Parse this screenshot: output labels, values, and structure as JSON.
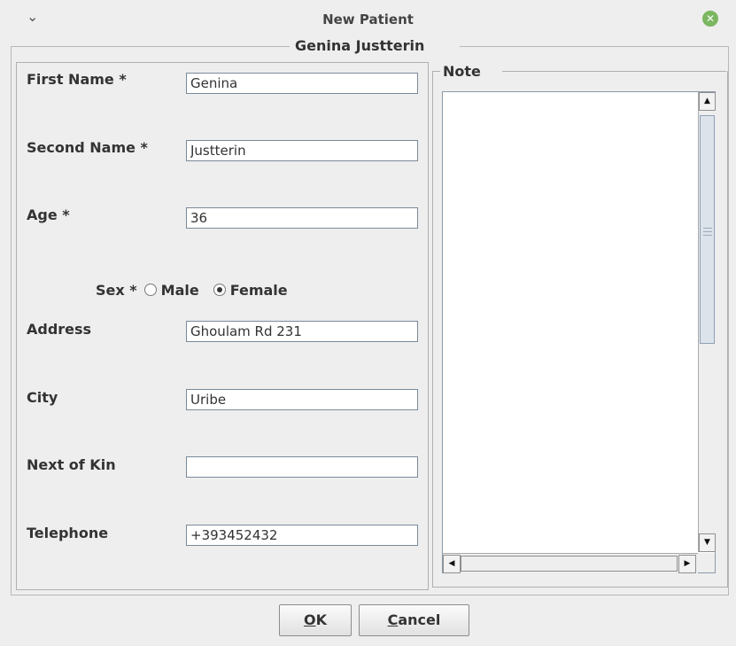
{
  "window": {
    "title": "New Patient",
    "menu_glyph": "⌄",
    "close_glyph": "✕"
  },
  "form": {
    "title": "Genina Justterin",
    "fields": [
      {
        "label": "First Name *",
        "value": "Genina"
      },
      {
        "label": "Second Name *",
        "value": "Justterin"
      },
      {
        "label": "Age *",
        "value": "36"
      },
      {
        "label": "Address",
        "value": "Ghoulam Rd 231"
      },
      {
        "label": "City",
        "value": "Uribe"
      },
      {
        "label": "Next of Kin",
        "value": ""
      },
      {
        "label": "Telephone",
        "value": "+393452432"
      }
    ],
    "sex": {
      "label": "Sex *",
      "options": [
        "Male",
        "Female"
      ],
      "selected": "Female"
    }
  },
  "note": {
    "label": "Note",
    "value": ""
  },
  "buttons": {
    "ok": {
      "mnemonic": "O",
      "rest": "K"
    },
    "cancel": {
      "mnemonic": "C",
      "rest": "ancel"
    }
  },
  "colors": {
    "close_button": "#7bb661"
  }
}
